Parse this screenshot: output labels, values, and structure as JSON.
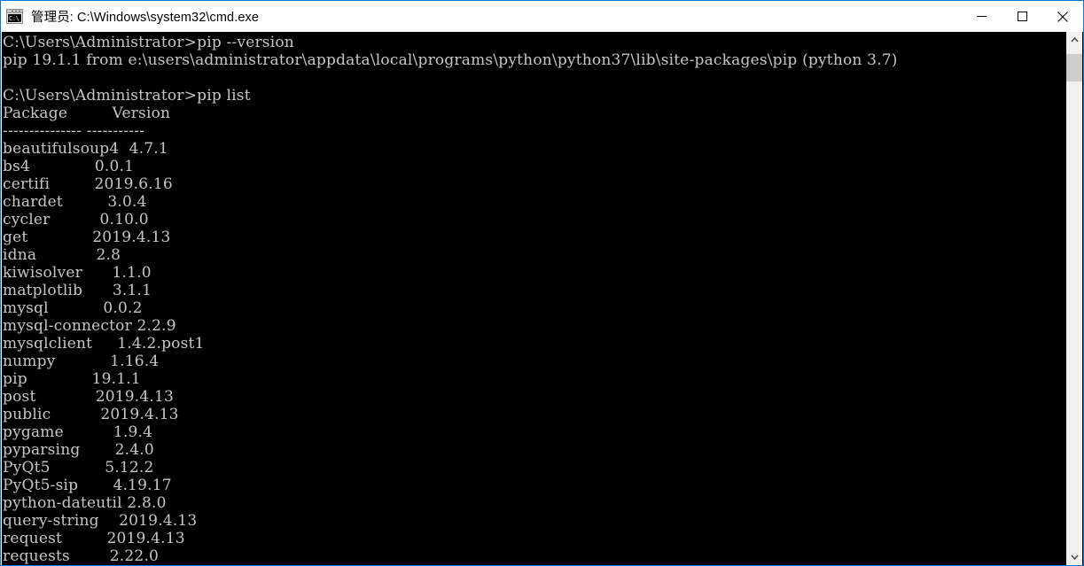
{
  "window": {
    "title": "管理员: C:\\Windows\\system32\\cmd.exe",
    "icon": "cmd-console-icon",
    "icon_text": "C:\\_",
    "border_color": "#0078d7",
    "titlebar_bg": "#ffffff",
    "titlebar_fg": "#000000"
  },
  "caption": {
    "minimize_label": "Minimize",
    "maximize_label": "Maximize",
    "close_label": "Close"
  },
  "console": {
    "background": "#000000",
    "foreground": "#c6c6c6",
    "lines": [
      "C:\\Users\\Administrator>pip --version",
      "pip 19.1.1 from e:\\users\\administrator\\appdata\\local\\programs\\python\\python37\\lib\\site-packages\\pip (python 3.7)",
      "",
      "C:\\Users\\Administrator>pip list",
      "Package         Version",
      "--------------- -----------",
      "beautifulsoup4  4.7.1",
      "bs4             0.0.1",
      "certifi         2019.6.16",
      "chardet         3.0.4",
      "cycler          0.10.0",
      "get             2019.4.13",
      "idna            2.8",
      "kiwisolver      1.1.0",
      "matplotlib      3.1.1",
      "mysql           0.0.2",
      "mysql-connector 2.2.9",
      "mysqlclient     1.4.2.post1",
      "numpy           1.16.4",
      "pip             19.1.1",
      "post            2019.4.13",
      "public          2019.4.13",
      "pygame          1.9.4",
      "pyparsing       2.4.0",
      "PyQt5           5.12.2",
      "PyQt5-sip       4.19.17",
      "python-dateutil 2.8.0",
      "query-string    2019.4.13",
      "request         2019.4.13",
      "requests        2.22.0"
    ],
    "commands": [
      "pip --version",
      "pip list"
    ],
    "prompt": "C:\\Users\\Administrator>",
    "table": {
      "headers": [
        "Package",
        "Version"
      ],
      "rows": [
        [
          "beautifulsoup4",
          "4.7.1"
        ],
        [
          "bs4",
          "0.0.1"
        ],
        [
          "certifi",
          "2019.6.16"
        ],
        [
          "chardet",
          "3.0.4"
        ],
        [
          "cycler",
          "0.10.0"
        ],
        [
          "get",
          "2019.4.13"
        ],
        [
          "idna",
          "2.8"
        ],
        [
          "kiwisolver",
          "1.1.0"
        ],
        [
          "matplotlib",
          "3.1.1"
        ],
        [
          "mysql",
          "0.0.2"
        ],
        [
          "mysql-connector",
          "2.2.9"
        ],
        [
          "mysqlclient",
          "1.4.2.post1"
        ],
        [
          "numpy",
          "1.16.4"
        ],
        [
          "pip",
          "19.1.1"
        ],
        [
          "post",
          "2019.4.13"
        ],
        [
          "public",
          "2019.4.13"
        ],
        [
          "pygame",
          "1.9.4"
        ],
        [
          "pyparsing",
          "2.4.0"
        ],
        [
          "PyQt5",
          "5.12.2"
        ],
        [
          "PyQt5-sip",
          "4.19.17"
        ],
        [
          "python-dateutil",
          "2.8.0"
        ],
        [
          "query-string",
          "2019.4.13"
        ],
        [
          "request",
          "2019.4.13"
        ],
        [
          "requests",
          "2.22.0"
        ]
      ]
    }
  },
  "scrollbar": {
    "up_arrow": "chevron-up-icon",
    "down_arrow": "chevron-down-icon",
    "thumb_position": "near-top"
  }
}
